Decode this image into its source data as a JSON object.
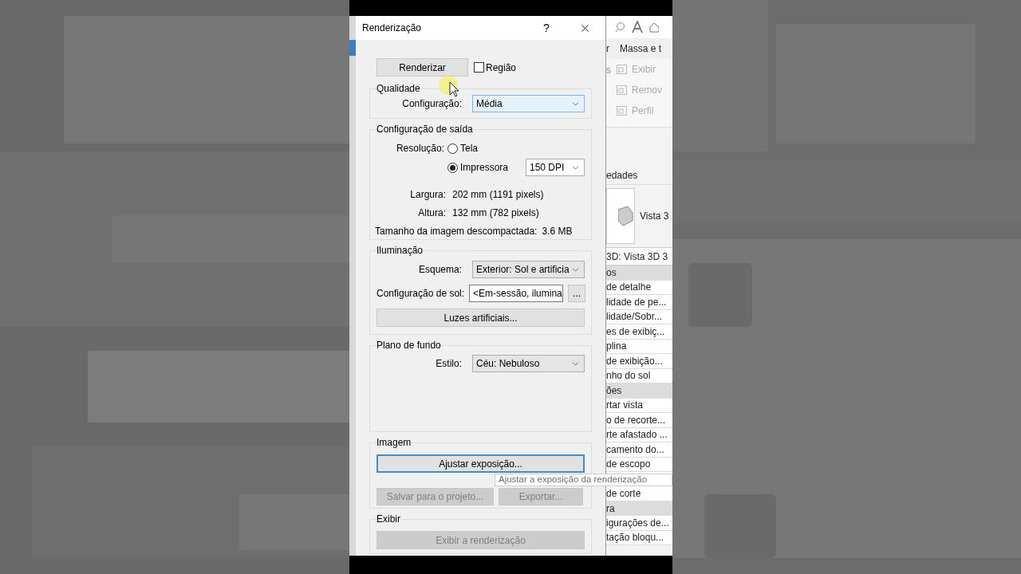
{
  "dialog": {
    "title": "Renderização",
    "help": "?",
    "render_button": "Renderizar",
    "region": {
      "label": "Região",
      "checked": false
    },
    "quality": {
      "title": "Qualidade",
      "setting_label": "Configuração:",
      "setting_value": "Média"
    },
    "output": {
      "title": "Configuração de saída",
      "resolution_label": "Resolução:",
      "options": [
        {
          "label": "Tela",
          "selected": false
        },
        {
          "label": "Impressora",
          "selected": true
        }
      ],
      "dpi": "150 DPI",
      "width_label": "Largura:",
      "width_value": "202 mm (1191 pixels)",
      "height_label": "Altura:",
      "height_value": "132 mm (782 pixels)",
      "size_label": "Tamanho da imagem descompactada:",
      "size_value": "3.6 MB"
    },
    "lighting": {
      "title": "Iluminação",
      "scheme_label": "Esquema:",
      "scheme_value": "Exterior: Sol e artificia",
      "sun_label": "Configuração de sol:",
      "sun_value": "<Em-sessão, ilumina",
      "sun_button": "...",
      "artificial_button": "Luzes artificiais..."
    },
    "background": {
      "title": "Plano de fundo",
      "style_label": "Estilo:",
      "style_value": "Céu: Nebuloso"
    },
    "image": {
      "title": "Imagem",
      "buttons": [
        {
          "label": "Ajustar exposição...",
          "disabled": false,
          "focused": true
        },
        {
          "label": "Salvar para o projeto...",
          "disabled": true,
          "focused": false
        },
        {
          "label": "Exportar...",
          "disabled": true,
          "focused": false
        }
      ]
    },
    "display": {
      "title": "Exibir",
      "button": {
        "label": "Exibir a renderização",
        "disabled": true
      }
    }
  },
  "tooltip": "Ajustar a exposição da renderização",
  "app": {
    "ribbon_tabs": [
      "r",
      "Massa e t"
    ],
    "ribbon_side": "s",
    "ribbon_buttons": [
      "Exibir",
      "Remov",
      "Perfil"
    ],
    "properties_title": "edades",
    "type_name": "Vista 3",
    "view_selector": "3D: Vista 3D 3",
    "rows": [
      {
        "kind": "group",
        "text": "os"
      },
      {
        "kind": "row",
        "text": "de detalhe"
      },
      {
        "kind": "row",
        "text": "lidade de pe..."
      },
      {
        "kind": "row",
        "text": "lidade/Sobr..."
      },
      {
        "kind": "row",
        "text": "es de exibiç..."
      },
      {
        "kind": "row",
        "text": "plina"
      },
      {
        "kind": "row",
        "text": "de exibição..."
      },
      {
        "kind": "row",
        "text": "nho do sol"
      },
      {
        "kind": "group",
        "text": "ões"
      },
      {
        "kind": "row",
        "text": "rtar vista"
      },
      {
        "kind": "row",
        "text": "o de recorte..."
      },
      {
        "kind": "row",
        "text": "rte afastado ..."
      },
      {
        "kind": "row",
        "text": "camento do..."
      },
      {
        "kind": "row",
        "text": "de escopo"
      },
      {
        "kind": "row",
        "text": "de corte"
      },
      {
        "kind": "group",
        "text": "ra"
      },
      {
        "kind": "row",
        "text": "igurações de..."
      },
      {
        "kind": "row",
        "text": "tação bloqu..."
      }
    ]
  }
}
